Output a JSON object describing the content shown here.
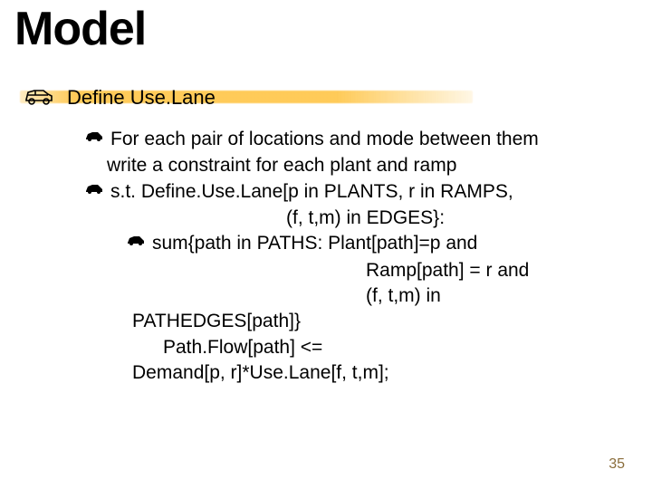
{
  "title": "Model",
  "bullet_level1": "Define Use.Lane",
  "body": {
    "b1_line1": "For each pair of locations and mode between them",
    "b1_line2": "write a constraint for each plant and ramp",
    "b2_line1": "s.t. Define.Use.Lane[p in PLANTS, r in RAMPS,",
    "b2_line2": "(f, t,m) in EDGES}:",
    "b3_line1": "sum{path in PATHS: Plant[path]=p and",
    "b3_line2": "Ramp[path] = r and",
    "b3_line3": "(f, t,m) in",
    "code1": "PATHEDGES[path]}",
    "code2": "Path.Flow[path] <=",
    "code3": "Demand[p, r]*Use.Lane[f, t,m];"
  },
  "page_number": "35",
  "icons": {
    "car_outline": "car-outline-icon",
    "car_solid": "car-solid-icon"
  }
}
